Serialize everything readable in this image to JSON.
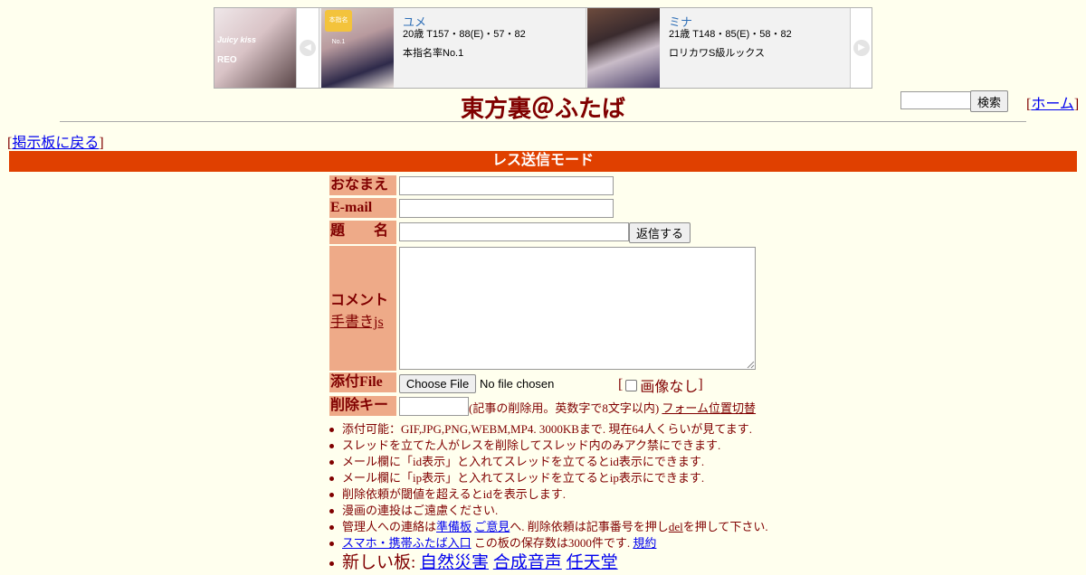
{
  "ad": {
    "logo_text": "Juicy kiss",
    "logo_sub": "REO",
    "badge_text": "本指名No.1",
    "cards": [
      {
        "name": "ユメ",
        "stats": "20歳 T157・88(E)・57・82",
        "desc": "本指名率No.1"
      },
      {
        "name": "ミナ",
        "stats": "21歳 T148・85(E)・58・82",
        "desc": "ロリカワS級ルックス"
      }
    ]
  },
  "header": {
    "title": "東方裏＠ふたば",
    "search_button": "検索",
    "home_link": "ホーム",
    "back_link": "掲示板に戻る"
  },
  "mode_bar": "レス送信モード",
  "form": {
    "name_label": "おなまえ",
    "email_label": "E-mail",
    "subject_label": "題　　名",
    "submit_button": "返信する",
    "comment_label": "コメント",
    "handwrite_link": "手書きjs",
    "file_label": "添付File",
    "file_button": "Choose File",
    "file_status": "No file chosen",
    "no_image_label": "画像なし",
    "delete_label": "削除キー",
    "delete_note": "(記事の削除用。英数字で8文字以内)",
    "form_toggle_link": "フォーム位置切替"
  },
  "notes": {
    "n1": "添付可能：GIF,JPG,PNG,WEBM,MP4. 3000KBまで. 現在64人くらいが見てます.",
    "n2": "スレッドを立てた人がレスを削除してスレッド内のみアク禁にできます.",
    "n3": "メール欄に「id表示」と入れてスレッドを立てるとid表示にできます.",
    "n4": "メール欄に「ip表示」と入れてスレッドを立てるとip表示にできます.",
    "n5": "削除依頼が閾値を超えるとidを表示します.",
    "n6": "漫画の連投はご遠慮ください.",
    "n7_pre": "管理人への連絡は",
    "n7_link1": "準備板",
    "n7_link2": "ご意見",
    "n7_mid": "へ. 削除依頼は記事番号を押し",
    "n7_link3": "del",
    "n7_post": "を押して下さい.",
    "n8_link1": "スマホ・携帯ふたば入口",
    "n8_mid": " この板の保存数は3000件です. ",
    "n8_link2": "規約",
    "n9_pre": "新しい板: ",
    "n9_link1": "自然災害",
    "n9_link2": "合成音声",
    "n9_link3": "任天堂"
  },
  "colors": {
    "background": "#ffffee",
    "text": "#800000",
    "mode_bar": "#e04000",
    "label_bg": "#eeaa88",
    "link": "#0000ee"
  }
}
